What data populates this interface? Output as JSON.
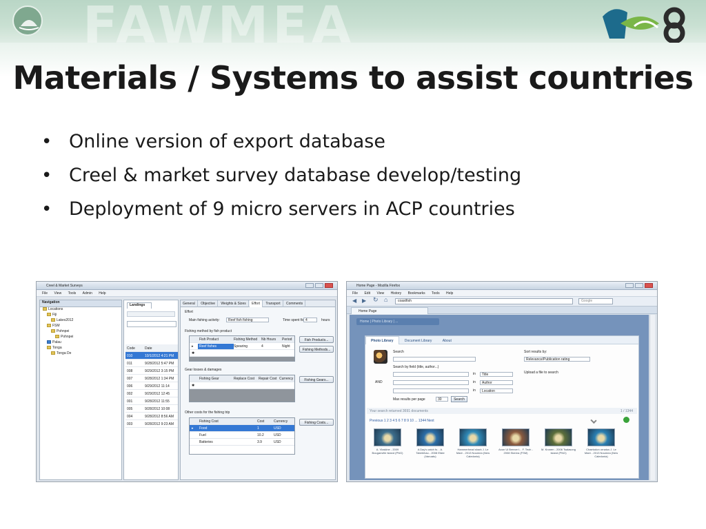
{
  "header": {
    "watermark": "FAWMEA",
    "logo": {
      "text": "hof8",
      "colors": [
        "#1d6b8c",
        "#7ab648",
        "#2c2c2c"
      ]
    }
  },
  "title": "Materials / Systems to assist countries",
  "bullets": [
    "Online version of export database",
    "Creel & market survey database develop/testing",
    "Deployment of 9 micro servers in ACP countries"
  ],
  "left_screenshot": {
    "window_title": "Creel & Market Surveys",
    "menu": [
      "File",
      "View",
      "Tools",
      "Admin",
      "Help"
    ],
    "navigation": {
      "header": "Navigation",
      "tree": [
        "Locations",
        "Fiji",
        "Lakes2012",
        "FSM",
        "Pohnpei",
        "Pohnpei",
        "Palau",
        "Tonga",
        "Tonga De"
      ]
    },
    "landings": {
      "tab": "Landings",
      "columns": [
        "Code",
        "Date"
      ],
      "rows": [
        [
          "010",
          "10/1/2012 4:21 PM"
        ],
        [
          "011",
          "9/28/2012 5:47 PM"
        ],
        [
          "008",
          "9/29/2012 3:15 PM"
        ],
        [
          "007",
          "9/28/2012 1:34 PM"
        ],
        [
          "006",
          "9/29/2012 11:14"
        ],
        [
          "002",
          "9/29/2012 12:45"
        ],
        [
          "001",
          "9/28/2012 11:55"
        ],
        [
          "005",
          "9/28/2012 10:08"
        ],
        [
          "004",
          "9/28/2012 8:56 AM"
        ],
        [
          "003",
          "9/28/2012 9:23 AM"
        ]
      ],
      "selected_index": 0
    },
    "detail": {
      "tabs": [
        "General",
        "Objective",
        "Weights & Sizes",
        "Effort",
        "Transport",
        "Comments"
      ],
      "active_tab": "Effort",
      "effort_label": "Effort",
      "main_activity_label": "Main fishing activity:",
      "main_activity_value": "Reef fish fishing",
      "time_spent_label": "Time spent fishing:",
      "time_spent_value": "4",
      "time_spent_unit": "hours",
      "method_section": "Fishing method by fish product",
      "method_columns": [
        "Fish Product",
        "Fishing Method",
        "Nb Hours",
        "Period"
      ],
      "method_rows": [
        [
          "Reef fishes",
          "Spearing",
          "4",
          "Night"
        ]
      ],
      "buttons_top": [
        "Fish Products...",
        "Fishing Methods..."
      ],
      "gear_section": "Gear losses & damages",
      "gear_columns": [
        "Fishing Gear",
        "Replace Cost",
        "Repair Cost",
        "Currency"
      ],
      "gear_button": "Fishing Gears...",
      "cost_section": "Other costs for the fishing trip",
      "cost_columns": [
        "Fishing Cost",
        "Cost",
        "Currency"
      ],
      "cost_rows": [
        [
          "Food",
          "1",
          "USD"
        ],
        [
          "Fuel",
          "10.2",
          "USD"
        ],
        [
          "Batteries",
          "3.9",
          "USD"
        ]
      ],
      "cost_button": "Fishing Costs..."
    }
  },
  "right_screenshot": {
    "window_title": "Home Page - Mozilla Firefox",
    "menu": [
      "File",
      "Edit",
      "View",
      "History",
      "Bookmarks",
      "Tools",
      "Help"
    ],
    "url": "coastfish",
    "search_placeholder": "Google",
    "tab_label": "Home Page",
    "breadcrumb": "Home | Photo Library | ...",
    "library_tabs": [
      "Photo Library",
      "Document Library",
      "About"
    ],
    "search_label": "Search",
    "search_by_label": "Search by field (title, author...)",
    "sort_label": "Sort results by:",
    "sort_value": "Relevance/Publication rating",
    "upload_label": "Upload a file to search",
    "and_label": "AND",
    "in_label": "in",
    "field_options": [
      "Title",
      "Author",
      "Location"
    ],
    "max_results_label": "Max results per page",
    "max_results_value": "30",
    "search_button": "Search",
    "result_summary": "Your search returned 3691 documents",
    "result_page": "1 / 1344",
    "pager": "Previous 1 2 3 4 5 6 7 8 9 10 ... 1344 Next",
    "thumbnails": [
      {
        "caption": "A. Vlaskine - 2009 Bouganville Island (PNG)",
        "color": "#3d6e8c"
      },
      {
        "caption": "A Day's catch fo... A. Tabelehau - 2008 Efate (Vanuatu)",
        "color": "#2b6ea8"
      },
      {
        "caption": "Hammerhead shark J. Le Mare - 2013 Noumea (New Caledonia)",
        "color": "#2f8ab8"
      },
      {
        "caption": "Axon Ul Breeze t... F. Teoh - 2008 Skerea (FSM)",
        "color": "#8a5a3e"
      },
      {
        "caption": "M. Kronen - 2006 Tsalasong Island (PNG)",
        "color": "#5c6e3a"
      },
      {
        "caption": "Chaetodon ornatus J. Le Mare - 2013 Noumea (New Caledonia)",
        "color": "#2a7fb2"
      }
    ]
  }
}
